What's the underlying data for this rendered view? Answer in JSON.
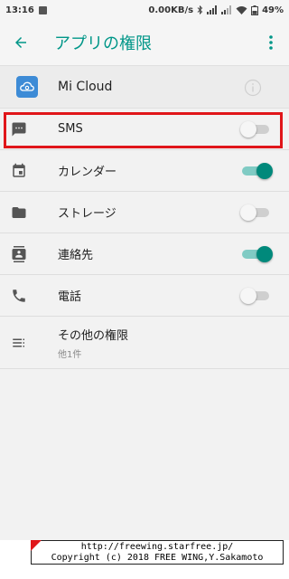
{
  "status_bar": {
    "time": "13:16",
    "speed": "0.00KB/s",
    "battery": "49%"
  },
  "app_bar": {
    "title": "アプリの権限"
  },
  "app": {
    "name": "Mi Cloud"
  },
  "permissions": [
    {
      "label": "SMS",
      "enabled": false
    },
    {
      "label": "カレンダー",
      "enabled": true
    },
    {
      "label": "ストレージ",
      "enabled": false
    },
    {
      "label": "連絡先",
      "enabled": true
    },
    {
      "label": "電話",
      "enabled": false
    }
  ],
  "other": {
    "label": "その他の権限",
    "sub": "他1件"
  },
  "watermark": {
    "line1": "http://freewing.starfree.jp/",
    "line2": "Copyright (c) 2018 FREE WING,Y.Sakamoto"
  },
  "colors": {
    "accent": "#009688",
    "toggle_on": "#00897b",
    "highlight": "#e0161a",
    "app_icon": "#3d8bd6"
  }
}
